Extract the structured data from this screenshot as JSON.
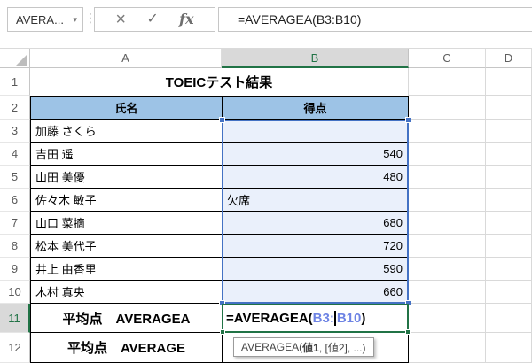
{
  "name_box": {
    "value": "AVERA...",
    "caret_icon": "▾"
  },
  "formula_bar": {
    "dots_icon": "⋮",
    "cancel_icon": "×",
    "enter_icon": "✓",
    "fx_icon": "fx",
    "formula": "=AVERAGEA(B3:B10)"
  },
  "colors": {
    "selection_green": "#217346",
    "range_border_blue": "#4472c4",
    "range_ref_text_blue": "#6d83e4",
    "table_header_fill": "#9dc3e6",
    "range_fill": "#eaf0fb",
    "selected_header_fill": "#d9d9d9"
  },
  "sheet": {
    "column_headers": [
      "A",
      "B",
      "C",
      "D"
    ],
    "selected_column": "B",
    "title_row": {
      "num": "1",
      "title": "TOEICテスト結果"
    },
    "header_row": {
      "num": "2",
      "name": "氏名",
      "score": "得点"
    },
    "rows": [
      {
        "num": "3",
        "name": "加藤 さくら",
        "score": ""
      },
      {
        "num": "4",
        "name": "吉田 遥",
        "score": "540"
      },
      {
        "num": "5",
        "name": "山田 美優",
        "score": "480"
      },
      {
        "num": "6",
        "name": "佐々木 敏子",
        "score": "欠席"
      },
      {
        "num": "7",
        "name": "山口 菜摘",
        "score": "680"
      },
      {
        "num": "8",
        "name": "松本 美代子",
        "score": "720"
      },
      {
        "num": "9",
        "name": "井上 由香里",
        "score": "590"
      },
      {
        "num": "10",
        "name": "木村 真央",
        "score": "660"
      }
    ],
    "row11": {
      "num": "11",
      "label": "平均点　AVERAGEA",
      "formula_prefix": "=AVERAGEA(",
      "formula_ref_before_cursor": "B3:",
      "formula_ref_after_cursor": "B10",
      "formula_suffix": ")"
    },
    "row12": {
      "num": "12",
      "label": "平均点　AVERAGE"
    },
    "tooltip": {
      "prefix": "AVERAGEA(",
      "arg1": "値1",
      "rest": ", [値2], ...)"
    }
  }
}
